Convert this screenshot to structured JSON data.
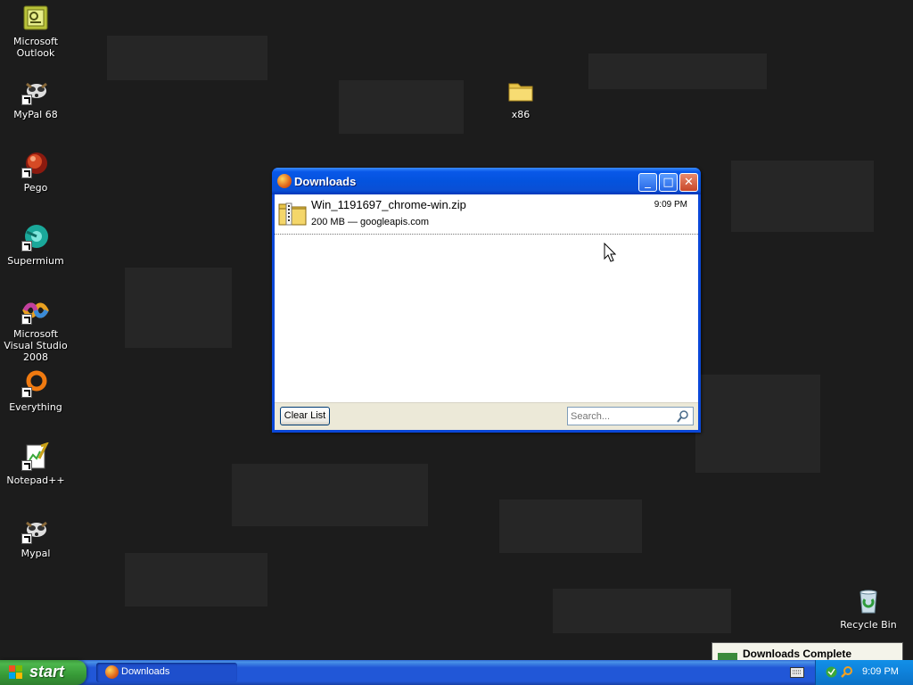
{
  "desktop": {
    "icons": [
      {
        "label": "Microsoft Outlook",
        "icon": "outlook-icon"
      },
      {
        "label": "MyPal 68",
        "icon": "mypal-icon"
      },
      {
        "label": "Pego",
        "icon": "pego-icon"
      },
      {
        "label": "Supermium",
        "icon": "supermium-icon"
      },
      {
        "label": "Microsoft Visual Studio 2008",
        "icon": "visual-studio-icon"
      },
      {
        "label": "Everything",
        "icon": "everything-icon"
      },
      {
        "label": "Notepad++",
        "icon": "notepadpp-icon"
      },
      {
        "label": "Mypal",
        "icon": "mypal-icon"
      },
      {
        "label": "x86",
        "icon": "folder-icon"
      },
      {
        "label": "Recycle Bin",
        "icon": "recycle-bin-icon"
      }
    ]
  },
  "window": {
    "title": "Downloads",
    "buttons": {
      "minimize": "_",
      "maximize": "□",
      "close": "✕"
    },
    "downloads": [
      {
        "name": "Win_1191697_chrome-win.zip",
        "info": "200 MB — googleapis.com",
        "time": "9:09 PM"
      }
    ],
    "clear_label": "Clear List",
    "search_placeholder": "Search..."
  },
  "taskbar": {
    "start_label": "start",
    "task_label": "Downloads",
    "clock": "9:09 PM"
  },
  "notification": {
    "title": "Downloads Complete"
  },
  "colors": {
    "desktop_bg": "#1c1c1c",
    "titlebar": "#0453de",
    "taskbar": "#2157d7",
    "start_green": "#379a37",
    "tray_blue": "#0f84dd"
  }
}
